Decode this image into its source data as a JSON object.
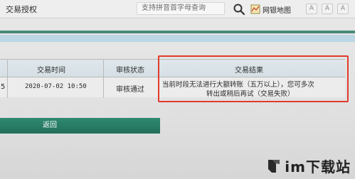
{
  "header": {
    "title": "交易授权",
    "search_placeholder": "支持拼音首字母查询",
    "map_link_label": "网银地图",
    "font_buttons": [
      "A",
      "A",
      "A"
    ]
  },
  "table": {
    "columns": [
      "交易时间",
      "审核状态",
      "交易结果"
    ],
    "row": {
      "prefix": "5",
      "time": "2020-07-02 10:50",
      "status": "审核通过",
      "result_line1": "当前时段无法进行大额转账（五万以上），您可多次",
      "result_line2": "转出或稍后再试（交易失败）"
    }
  },
  "actions": {
    "back_label": "返回"
  },
  "watermark": {
    "text": "im下载站"
  },
  "colors": {
    "accent_green": "#226e5b",
    "highlight_red": "#e23a2c",
    "strip_blue": "#bcd6e4"
  }
}
